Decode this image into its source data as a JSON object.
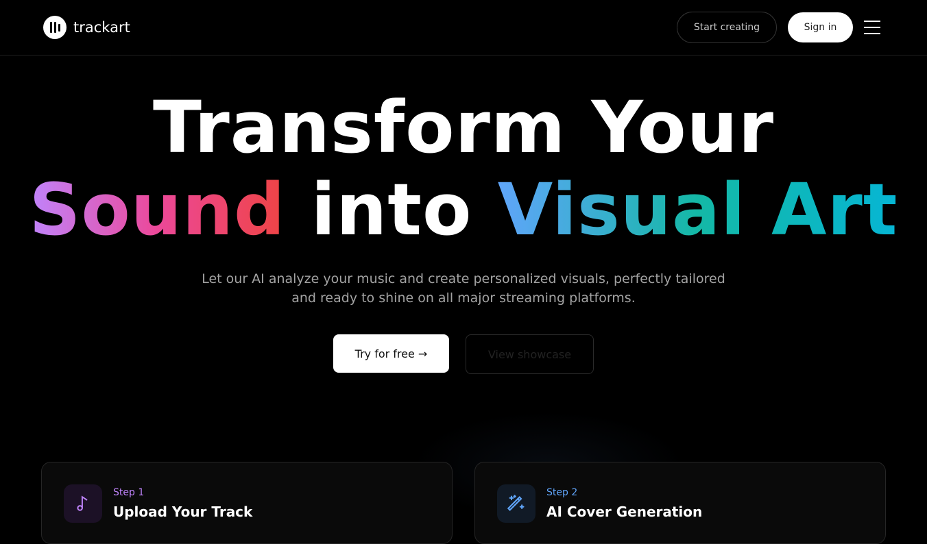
{
  "nav": {
    "brand": "trackart",
    "start_creating": "Start creating",
    "sign_in": "Sign in"
  },
  "hero": {
    "line1": "Transform Your",
    "word_sound": "Sound",
    "word_into": "into",
    "word_visual_art": "Visual Art",
    "subtitle": "Let our AI analyze your music and create personalized visuals, perfectly tailored and ready to shine on all major streaming platforms.",
    "try_free": "Try for free →",
    "view_showcase": "View showcase"
  },
  "steps": [
    {
      "step": "Step 1",
      "title": "Upload Your Track",
      "icon": "music-note-icon",
      "color": "#c084fc"
    },
    {
      "step": "Step 2",
      "title": "AI Cover Generation",
      "icon": "magic-wand-icon",
      "color": "#60a5fa"
    }
  ]
}
